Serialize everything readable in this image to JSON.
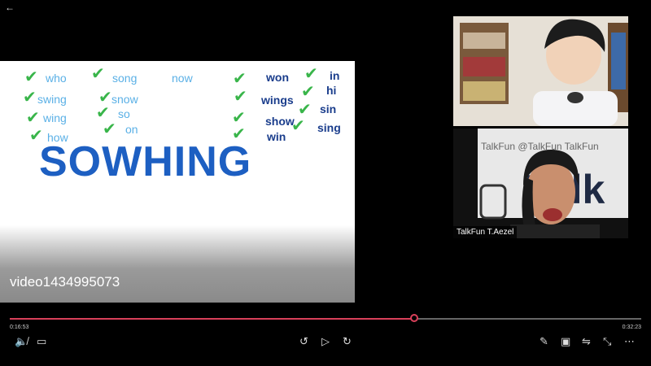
{
  "slide": {
    "light_words": [
      "who",
      "song",
      "now",
      "swing",
      "snow",
      "wing",
      "so",
      "how",
      "on"
    ],
    "dark_words": [
      "won",
      "in",
      "hi",
      "wings",
      "sin",
      "show",
      "sing",
      "win"
    ],
    "big_word": "SOWHING",
    "video_name": "video1434995073"
  },
  "participants": [
    {
      "label": ""
    },
    {
      "label": "TalkFun T.Aezel"
    }
  ],
  "player": {
    "current_time": "0:16:53",
    "total_time": "0:32:23",
    "progress": 0.64
  },
  "icons": {
    "back": "back-arrow-icon",
    "mute": "mute-icon",
    "captions": "captions-icon",
    "rewind": "rewind-10-icon",
    "play": "play-icon",
    "forward": "forward-30-icon",
    "edit": "pencil-icon",
    "miniview": "mini-view-icon",
    "cast": "cast-icon",
    "fullscreen": "exit-fullscreen-icon",
    "more": "more-icon"
  },
  "colors": {
    "accent": "#d9405a",
    "title": "#1d5fc2",
    "check": "#39b54a"
  }
}
